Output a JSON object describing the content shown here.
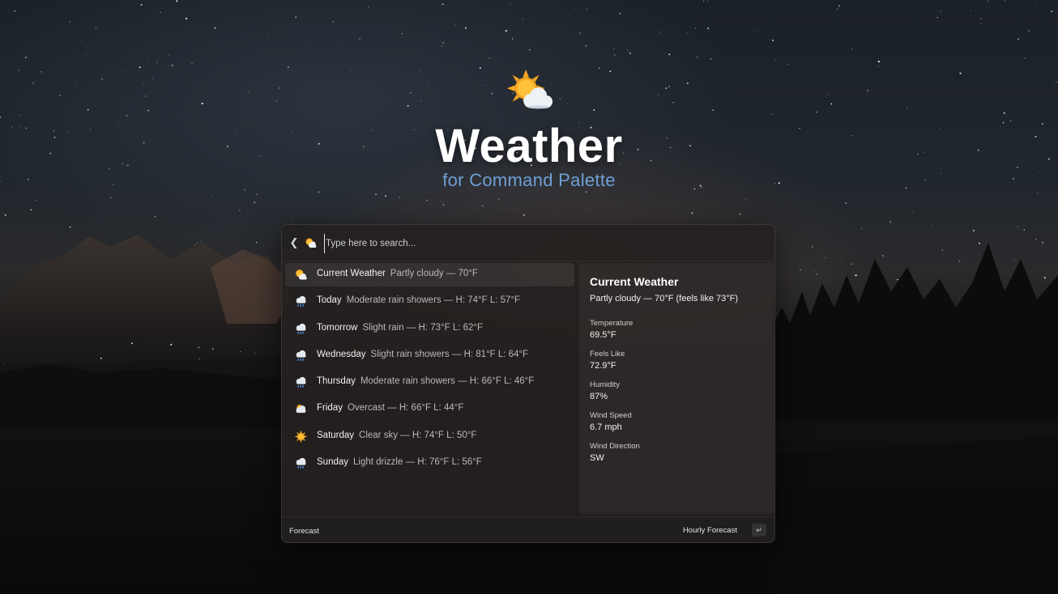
{
  "hero": {
    "title": "Weather",
    "subtitle": "for Command Palette",
    "icon": "sun-behind-cloud-icon"
  },
  "search": {
    "placeholder": "Type here to search...",
    "value": "",
    "back_icon": "chevron-left-icon",
    "extension_icon": "sun-behind-cloud-icon"
  },
  "list": [
    {
      "title": "Current Weather",
      "subtitle": "Partly cloudy — 70°F",
      "icon": "partly-cloudy-icon",
      "selected": true
    },
    {
      "title": "Today",
      "subtitle": "Moderate rain showers — H: 74°F L: 57°F",
      "icon": "rain-cloud-icon"
    },
    {
      "title": "Tomorrow",
      "subtitle": "Slight rain — H: 73°F L: 62°F",
      "icon": "rain-cloud-icon"
    },
    {
      "title": "Wednesday",
      "subtitle": "Slight rain showers — H: 81°F L: 64°F",
      "icon": "rain-cloud-icon"
    },
    {
      "title": "Thursday",
      "subtitle": "Moderate rain showers — H: 66°F L: 46°F",
      "icon": "rain-cloud-icon"
    },
    {
      "title": "Friday",
      "subtitle": "Overcast — H: 66°F L: 44°F",
      "icon": "overcast-cloud-icon"
    },
    {
      "title": "Saturday",
      "subtitle": "Clear sky — H: 74°F L: 50°F",
      "icon": "sun-icon"
    },
    {
      "title": "Sunday",
      "subtitle": "Light drizzle — H: 76°F L: 56°F",
      "icon": "rain-cloud-icon"
    }
  ],
  "details": {
    "title": "Current Weather",
    "summary": "Partly cloudy — 70°F (feels like 73°F)",
    "fields": [
      {
        "label": "Temperature",
        "value": "69.5°F"
      },
      {
        "label": "Feels Like",
        "value": "72.9°F"
      },
      {
        "label": "Humidity",
        "value": "87%"
      },
      {
        "label": "Wind Speed",
        "value": "6.7 mph"
      },
      {
        "label": "Wind Direction",
        "value": "SW"
      }
    ]
  },
  "footer": {
    "left_label": "Forecast",
    "action_label": "Hourly Forecast",
    "action_key": "↵"
  },
  "colors": {
    "subtitle_accent": "#6f9fd8",
    "palette_bg": "#24201f",
    "selected_row": "#3a3636"
  }
}
